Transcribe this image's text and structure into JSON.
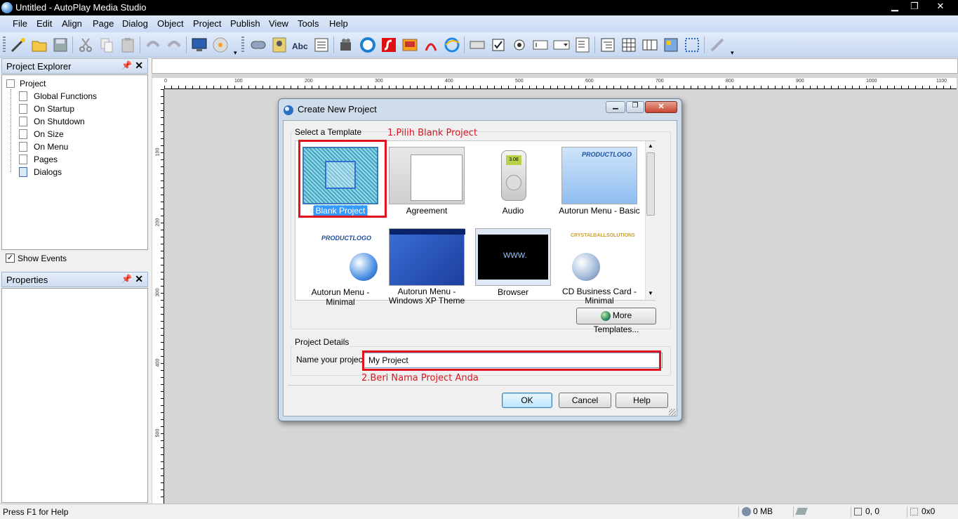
{
  "window": {
    "title": "Untitled - AutoPlay Media Studio",
    "minimize": "▁",
    "restore": "❐",
    "close": "✕"
  },
  "menu": [
    "File",
    "Edit",
    "Align",
    "Page",
    "Dialog",
    "Object",
    "Project",
    "Publish",
    "View",
    "Tools",
    "Help"
  ],
  "explorer": {
    "title": "Project Explorer",
    "root": "Project",
    "items": [
      "Global Functions",
      "On Startup",
      "On Shutdown",
      "On Size",
      "On Menu",
      "Pages",
      "Dialogs"
    ],
    "show_events": "Show Events"
  },
  "properties": {
    "title": "Properties"
  },
  "ruler": {
    "h": [
      "0",
      "100",
      "200",
      "300",
      "400",
      "500",
      "600",
      "700",
      "800",
      "900",
      "1000",
      "1100"
    ],
    "v": [
      "100",
      "200",
      "300",
      "400",
      "500"
    ]
  },
  "dialog": {
    "title": "Create New Project",
    "select_label": "Select a Template",
    "templates": [
      "Blank Project",
      "Agreement",
      "Audio",
      "Autorun Menu - Basic",
      "Autorun Menu - Minimal",
      "Autorun Menu - Windows XP Theme",
      "Browser",
      "CD Business Card - Minimal"
    ],
    "thumb_text": {
      "productlogo": "PRODUCTLOGO",
      "www": "WWW.",
      "crystal": "CRYSTALBALLSOLUTIONS",
      "audio": "3.08"
    },
    "more_templates": "More Templates...",
    "details_label": "Project Details",
    "name_label": "Name your project:",
    "name_value": "My Project",
    "ok": "OK",
    "cancel": "Cancel",
    "help": "Help"
  },
  "annotations": {
    "step1": "1.Pilih Blank Project",
    "step2": "2.Beri Nama Project Anda"
  },
  "status": {
    "help": "Press F1 for Help",
    "memory": "0 MB",
    "pos": "0, 0",
    "size": "0x0"
  }
}
